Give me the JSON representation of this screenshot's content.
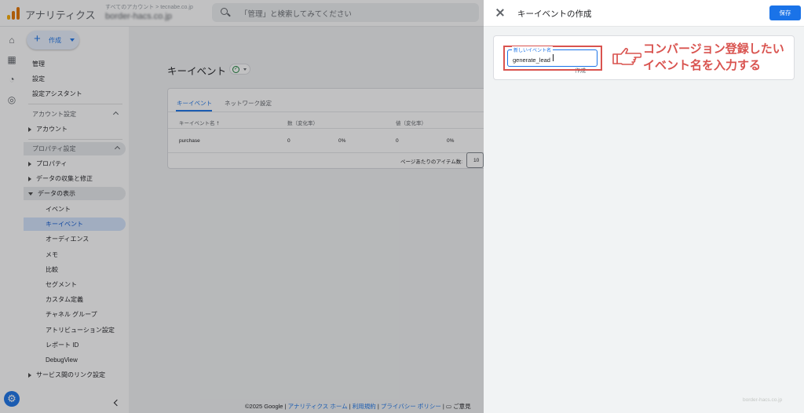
{
  "app": {
    "title": "アナリティクス",
    "account_small": "すべてのアカウント > tecnabe.co.jp",
    "account_main": "border-hacs.co.jp",
    "search_placeholder": "「管理」と検索してみてください"
  },
  "nav": {
    "create_label": "作成",
    "items": [
      {
        "label": "管理"
      },
      {
        "label": "設定"
      },
      {
        "label": "設定アシスタント"
      },
      {
        "label": "アカウント設定"
      },
      {
        "label": "アカウント"
      },
      {
        "label": "プロパティ設定"
      },
      {
        "label": "プロパティ"
      },
      {
        "label": "データの収集と修正"
      },
      {
        "label": "データの表示"
      },
      {
        "label": "イベント"
      },
      {
        "label": "キーイベント"
      },
      {
        "label": "オーディエンス"
      },
      {
        "label": "メモ"
      },
      {
        "label": "比較"
      },
      {
        "label": "セグメント"
      },
      {
        "label": "カスタム定義"
      },
      {
        "label": "チャネル グループ"
      },
      {
        "label": "アトリビューション設定"
      },
      {
        "label": "レポート ID"
      },
      {
        "label": "DebugView"
      },
      {
        "label": "サービス間のリンク設定"
      }
    ]
  },
  "main": {
    "page_title": "キーイベント",
    "tabs": [
      {
        "label": "キーイベント"
      },
      {
        "label": "ネットワーク設定"
      }
    ],
    "columns": [
      "キーイベント名",
      "数（変化率）",
      "値（変化率）"
    ],
    "rows": [
      {
        "name": "purchase",
        "count": "0",
        "count_change": "0%",
        "value": "0",
        "value_change": "0%"
      }
    ],
    "rows_per_page_label": "ページあたりのアイテム数:",
    "rows_per_page_value": "10",
    "footer": {
      "copyright": "©2025 Google |",
      "links": [
        "アナリティクス ホーム",
        "利用規約",
        "プライバシー ポリシー"
      ],
      "feedback": "ご意見"
    }
  },
  "panel": {
    "title": "キーイベントの作成",
    "save_label": "保存",
    "field_label": "新しいイベント名",
    "field_value": "generate_lead",
    "partial_text": "作成",
    "annotation_line1": "コンバージョン登録したい",
    "annotation_line2": "イベント名を入力する",
    "watermark": "border-hacs.co.jp"
  },
  "colors": {
    "accent": "#1a73e8",
    "annotation": "#d9534f",
    "success": "#188038"
  }
}
